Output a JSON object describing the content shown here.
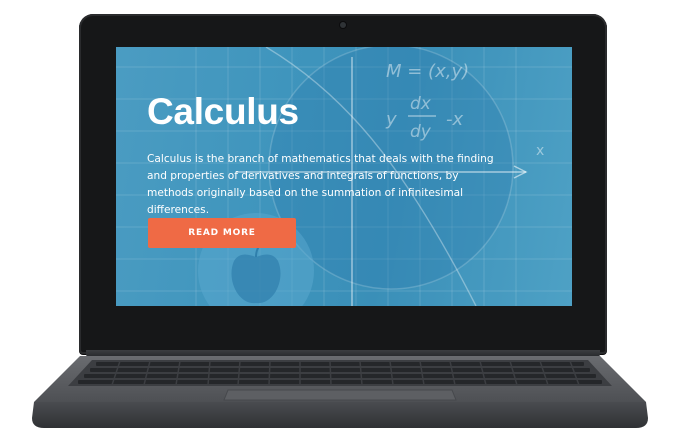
{
  "device": {
    "type": "laptop",
    "colors": {
      "bezel": "#161718",
      "body": "#5b5d61",
      "keys": "#2b2d30"
    }
  },
  "screen": {
    "colors": {
      "background": "#3f95bd",
      "accent": "#ef6a45",
      "text": "#ffffff"
    },
    "hero": {
      "title": "Calculus",
      "description": "Calculus is the branch of mathematics that deals with the finding and properties of derivatives and integrals of functions, by methods originally based on the summation of infinitesimal differences.",
      "button_label": "READ MORE"
    },
    "decor": {
      "formula_m": "M = (x,y)",
      "formula_y": "y",
      "formula_dx": "dx",
      "formula_dy": "dy",
      "formula_minus_x": "-x",
      "axis_x": "x"
    }
  }
}
